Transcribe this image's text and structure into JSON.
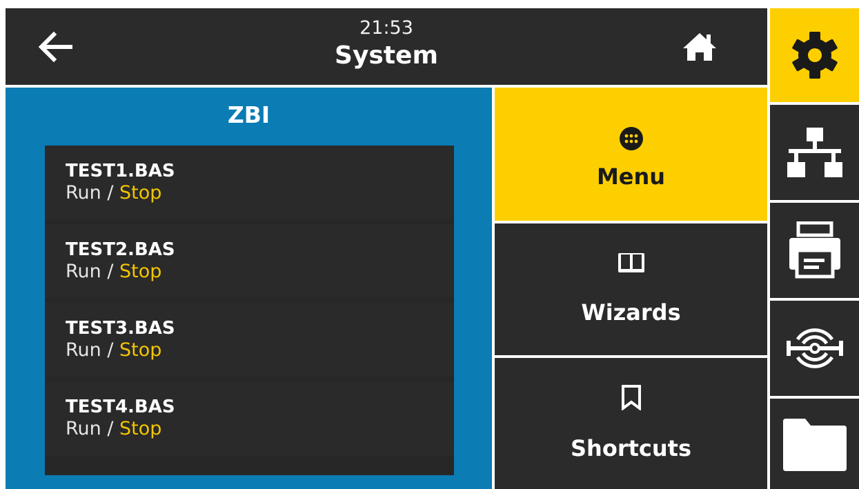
{
  "header": {
    "time": "21:53",
    "title": "System",
    "back_icon": "arrow-left-icon",
    "home_icon": "home-icon"
  },
  "panel": {
    "title": "ZBI",
    "files": [
      {
        "name": "TEST1.BAS",
        "run_label": "Run",
        "separator": " / ",
        "stop_label": "Stop"
      },
      {
        "name": "TEST2.BAS",
        "run_label": "Run",
        "separator": " / ",
        "stop_label": "Stop"
      },
      {
        "name": "TEST3.BAS",
        "run_label": "Run",
        "separator": " / ",
        "stop_label": "Stop"
      },
      {
        "name": "TEST4.BAS",
        "run_label": "Run",
        "separator": " / ",
        "stop_label": "Stop"
      }
    ]
  },
  "middle_menu": {
    "items": [
      {
        "label": "Menu",
        "icon": "grid-dots-icon",
        "active": true
      },
      {
        "label": "Wizards",
        "icon": "book-icon",
        "active": false
      },
      {
        "label": "Shortcuts",
        "icon": "bookmark-icon",
        "active": false
      }
    ]
  },
  "side_tabs": [
    {
      "icon": "gear-icon",
      "active": true
    },
    {
      "icon": "network-icon",
      "active": false
    },
    {
      "icon": "printer-icon",
      "active": false
    },
    {
      "icon": "wireless-icon",
      "active": false
    },
    {
      "icon": "folder-icon",
      "active": false
    }
  ],
  "colors": {
    "accent": "#fecf00",
    "panel_blue": "#0b7cb4",
    "dark": "#2b2b2b",
    "stop_text": "#f2c500"
  }
}
